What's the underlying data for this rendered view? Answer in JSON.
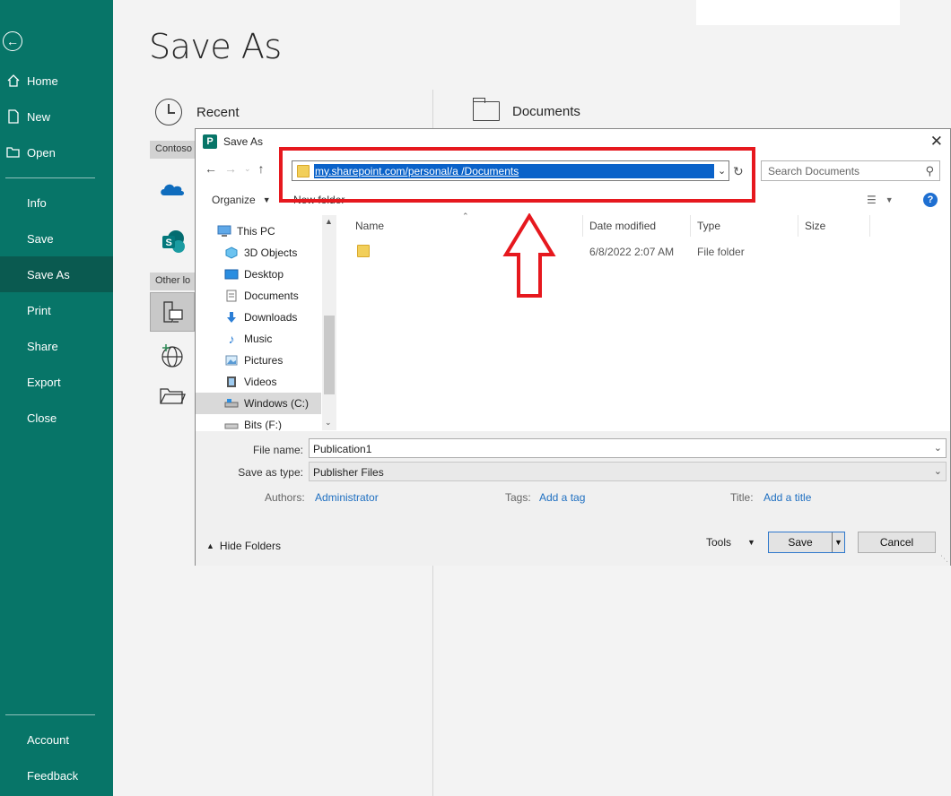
{
  "sidebar": {
    "items": [
      {
        "label": "Home",
        "icon": "home-icon"
      },
      {
        "label": "New",
        "icon": "new-document-icon"
      },
      {
        "label": "Open",
        "icon": "open-folder-icon"
      },
      {
        "label": "Info"
      },
      {
        "label": "Save"
      },
      {
        "label": "Save As",
        "active": true
      },
      {
        "label": "Print"
      },
      {
        "label": "Share"
      },
      {
        "label": "Export"
      },
      {
        "label": "Close"
      }
    ],
    "bottom_items": [
      {
        "label": "Account"
      },
      {
        "label": "Feedback"
      }
    ],
    "accent_color": "#077568"
  },
  "backstage": {
    "title": "Save As",
    "recent_label": "Recent",
    "group_contoso": "Contoso",
    "group_other": "Other lo",
    "documents_label": "Documents"
  },
  "dialog": {
    "title": "Save As",
    "address_path": "my.sharepoint.com/personal/a                                                              /Documents",
    "search_placeholder": "Search Documents",
    "organize_label": "Organize",
    "new_folder_label": "New folder",
    "nav_items": [
      {
        "label": "This PC",
        "icon": "computer-icon"
      },
      {
        "label": "3D Objects",
        "icon": "cube-icon"
      },
      {
        "label": "Desktop",
        "icon": "desktop-icon"
      },
      {
        "label": "Documents",
        "icon": "documents-icon"
      },
      {
        "label": "Downloads",
        "icon": "download-arrow-icon"
      },
      {
        "label": "Music",
        "icon": "music-note-icon"
      },
      {
        "label": "Pictures",
        "icon": "pictures-icon"
      },
      {
        "label": "Videos",
        "icon": "video-icon"
      },
      {
        "label": "Windows (C:)",
        "icon": "drive-icon",
        "selected": true
      },
      {
        "label": "Bits (F:)",
        "icon": "drive-icon"
      }
    ],
    "columns": {
      "name": "Name",
      "date_modified": "Date modified",
      "type": "Type",
      "size": "Size"
    },
    "files": [
      {
        "name": "",
        "date_modified": "6/8/2022 2:07 AM",
        "type": "File folder",
        "size": ""
      }
    ],
    "file_name_label": "File name:",
    "file_name_value": "Publication1",
    "save_as_type_label": "Save as type:",
    "save_as_type_value": "Publisher Files",
    "authors_label": "Authors:",
    "authors_value": "Administrator",
    "tags_label": "Tags:",
    "tags_value": "Add a tag",
    "title_label": "Title:",
    "title_value": "Add a title",
    "hide_folders_label": "Hide Folders",
    "tools_label": "Tools",
    "save_button": "Save",
    "cancel_button": "Cancel",
    "highlight_color": "#e6181e",
    "selection_color": "#0a62c9"
  }
}
